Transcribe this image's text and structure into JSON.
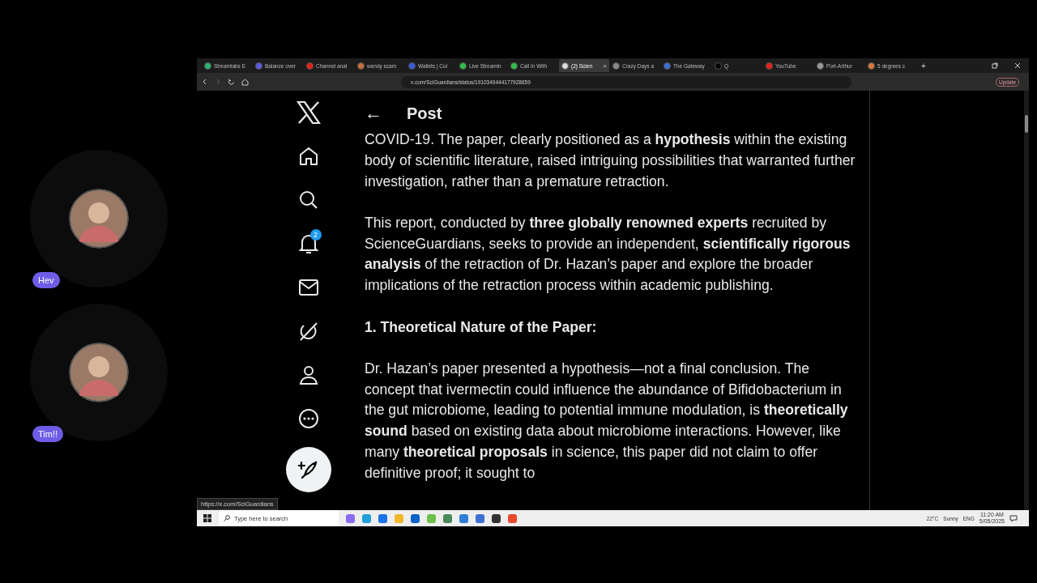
{
  "participants": [
    {
      "name": "Hev"
    },
    {
      "name": "Tim!!"
    }
  ],
  "browser": {
    "tabs": [
      {
        "title": "Streamlabs E",
        "color": "#2bb673",
        "selected": false
      },
      {
        "title": "Balance over",
        "color": "#5b5be0",
        "selected": false
      },
      {
        "title": "Channel anal",
        "color": "#e62117",
        "selected": false
      },
      {
        "title": "wendy scam",
        "color": "#c8703a",
        "selected": false
      },
      {
        "title": "Wallets | Coi",
        "color": "#3b5bdb",
        "selected": false
      },
      {
        "title": "Live Streamin",
        "color": "#2fbf4a",
        "selected": false
      },
      {
        "title": "Call In With",
        "color": "#2fbf4a",
        "selected": false
      },
      {
        "title": "(2) Scien",
        "color": "#dddddd",
        "selected": true
      },
      {
        "title": "Crazy Days a",
        "color": "#888888",
        "selected": false
      },
      {
        "title": "The Gateway",
        "color": "#3a6fd8",
        "selected": false
      },
      {
        "title": "Q",
        "color": "#000000",
        "selected": false
      },
      {
        "title": "YouTube",
        "color": "#e62117",
        "selected": false
      },
      {
        "title": "Port-Arthur",
        "color": "#999999",
        "selected": false
      },
      {
        "title": "5 degrees c",
        "color": "#d9773a",
        "selected": false
      }
    ],
    "close_tab": "×",
    "new_tab": "+",
    "address": "x.com/SciGuardians/status/1910349444177928659",
    "update_label": "Update",
    "status_url": "https://x.com/SciGuardians"
  },
  "x_nav": [
    {
      "kind": "logo"
    },
    {
      "kind": "home"
    },
    {
      "kind": "search"
    },
    {
      "kind": "notifications",
      "badge": "2"
    },
    {
      "kind": "messages"
    },
    {
      "kind": "grok"
    },
    {
      "kind": "profile"
    },
    {
      "kind": "more"
    },
    {
      "kind": "compose"
    }
  ],
  "post": {
    "back": "←",
    "title": "Post",
    "paragraphs": [
      {
        "kind": "text",
        "text": "COVID-19. The paper, clearly positioned as a **hypothesis** within the existing body of scientific literature, raised intriguing possibilities that warranted further investigation, rather than a premature retraction."
      },
      {
        "kind": "text",
        "text": "This report, conducted by **three globally renowned experts** recruited by ScienceGuardians, seeks to provide an independent, **scientifically rigorous analysis** of the retraction of Dr. Hazan’s paper and explore the broader implications of the retraction process within academic publishing."
      },
      {
        "kind": "heading",
        "text": "1. Theoretical Nature of the Paper:"
      },
      {
        "kind": "text",
        "text": "Dr. Hazan’s paper presented a hypothesis—not a final conclusion. The concept that ivermectin could influence the abundance of Bifidobacterium in the gut microbiome, leading to potential immune modulation, is **theoretically sound** based on existing data about microbiome interactions. However, like many **theoretical proposals** in science, this paper did not claim to offer definitive proof; it sought to"
      }
    ]
  },
  "taskbar": {
    "search_placeholder": "Type here to search",
    "apps": [
      {
        "color": "#8a6cf0"
      },
      {
        "color": "#1fa0d8"
      },
      {
        "color": "#1a73e8"
      },
      {
        "color": "#f2b62a"
      },
      {
        "color": "#0a64c8"
      },
      {
        "color": "#6cc04a"
      },
      {
        "color": "#4a8a5a"
      },
      {
        "color": "#2f7fd8"
      },
      {
        "color": "#3d6fd6"
      },
      {
        "color": "#333333"
      },
      {
        "color": "#e8492f"
      }
    ],
    "temperature": "22°C",
    "weather": "Sunny",
    "language": "ENG",
    "time": "11:20 AM",
    "date": "5/05/2025"
  }
}
